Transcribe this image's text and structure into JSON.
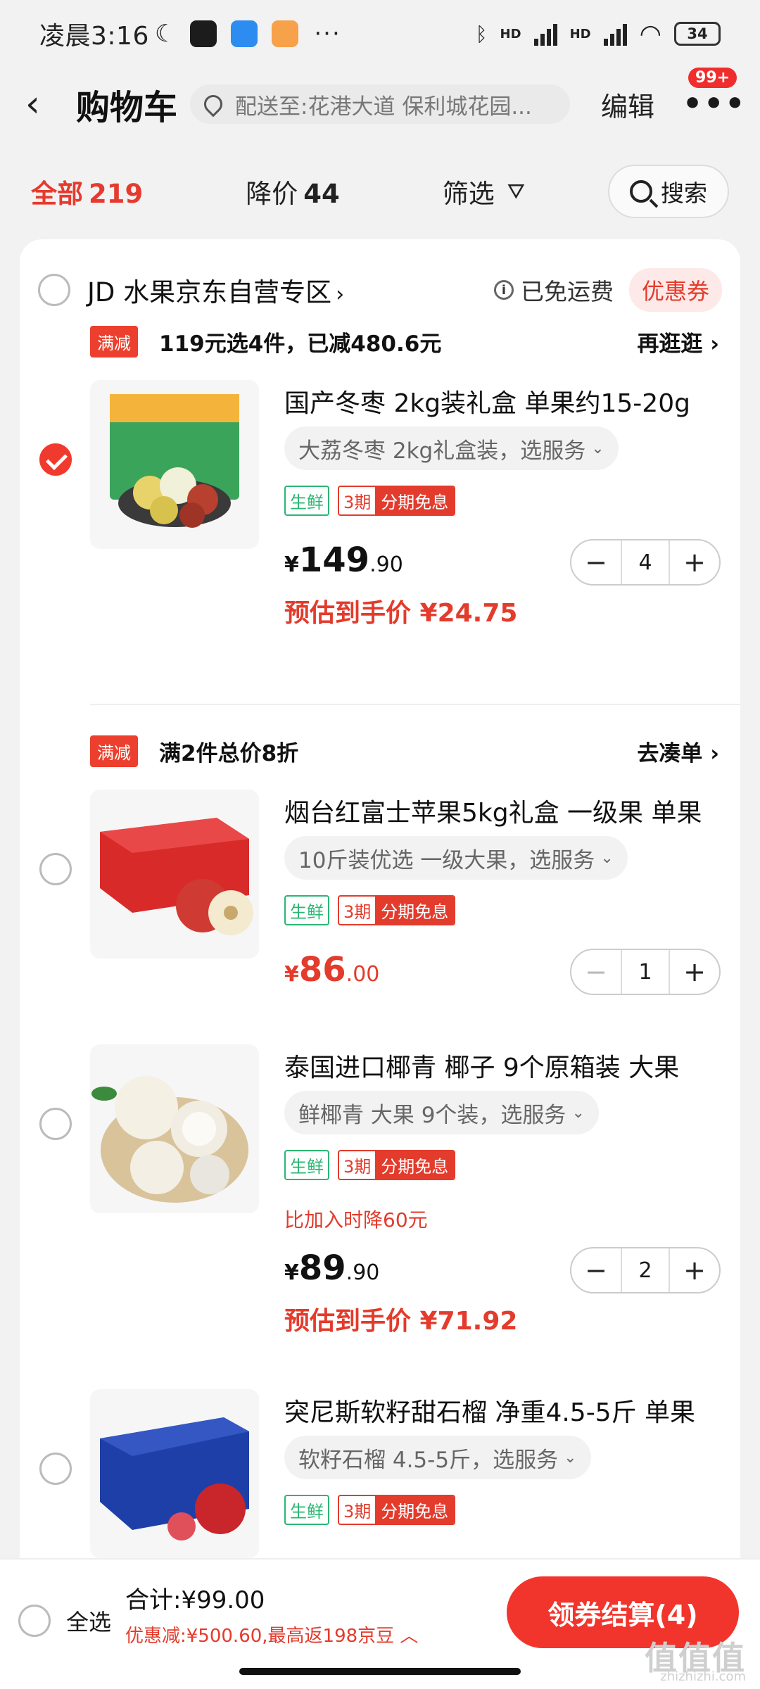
{
  "status_bar": {
    "time": "凌晨3:16",
    "moon": "☾",
    "more": "···",
    "bluetooth": "ᛒ",
    "hd1": "HD",
    "hd2": "HD",
    "wifi": "◠",
    "battery": "34"
  },
  "header": {
    "back": "‹",
    "title": "购物车",
    "address": "配送至:花港大道 保利城花园...",
    "edit": "编辑",
    "more": "•••",
    "badge": "99+"
  },
  "filter": {
    "all_label": "全部",
    "all_count": "219",
    "drop_label": "降价",
    "drop_count": "44",
    "screen_label": "筛选",
    "funnel": "⛛",
    "search_label": "搜索"
  },
  "store": {
    "name": "JD 水果京东自营专区",
    "chevron": "›",
    "free_shipping": "已免运费",
    "info": "i",
    "coupon": "优惠券"
  },
  "promos": [
    {
      "tag": "满减",
      "text": "119元选4件，已减480.6元",
      "link": "再逛逛 ›"
    },
    {
      "tag": "满减",
      "text": "满2件总价8折",
      "link": "去凑单 ›"
    }
  ],
  "items": [
    {
      "title": "国产冬枣   2kg装礼盒 单果约15-20g",
      "spec": "大荔冬枣 2kg礼盒装，选服务",
      "dropdown": "⌄",
      "tag_fresh": "生鲜",
      "tag_period": "3期",
      "tag_free": "分期免息",
      "price_currency": "¥",
      "price_int": "149",
      "price_dec": ".90",
      "est_label": "预估到手价 ¥24.75",
      "qty": "4",
      "checked": true
    },
    {
      "title": "烟台红富士苹果5kg礼盒 一级果 单果",
      "spec": "10斤装优选  一级大果，选服务",
      "dropdown": "⌄",
      "tag_fresh": "生鲜",
      "tag_period": "3期",
      "tag_free": "分期免息",
      "price_currency": "¥",
      "price_int": "86",
      "price_dec": ".00",
      "qty": "1",
      "checked": false
    },
    {
      "title": "泰国进口椰青 椰子 9个原箱装 大果",
      "spec": "鲜椰青 大果 9个装，选服务",
      "dropdown": "⌄",
      "tag_fresh": "生鲜",
      "tag_period": "3期",
      "tag_free": "分期免息",
      "drop_note": "比加入时降60元",
      "price_currency": "¥",
      "price_int": "89",
      "price_dec": ".90",
      "est_label": "预估到手价 ¥71.92",
      "qty": "2",
      "checked": false
    },
    {
      "title": "突尼斯软籽甜石榴 净重4.5-5斤 单果",
      "spec": "软籽石榴 4.5-5斤，选服务",
      "dropdown": "⌄",
      "tag_fresh": "生鲜",
      "tag_period": "3期",
      "tag_free": "分期免息",
      "checked": false
    }
  ],
  "stepper": {
    "minus": "−",
    "plus": "+"
  },
  "bottom": {
    "select_all": "全选",
    "total": "合计:¥99.00",
    "discount": "优惠减:¥500.60,最高返198京豆 ︿",
    "checkout": "领券结算(4)"
  },
  "watermark": {
    "main": "值值值",
    "sub": "zhizhizhi.com"
  },
  "colors": {
    "accent": "#e33b2c",
    "checkout": "#f2352c",
    "fresh_green": "#2bb673"
  }
}
